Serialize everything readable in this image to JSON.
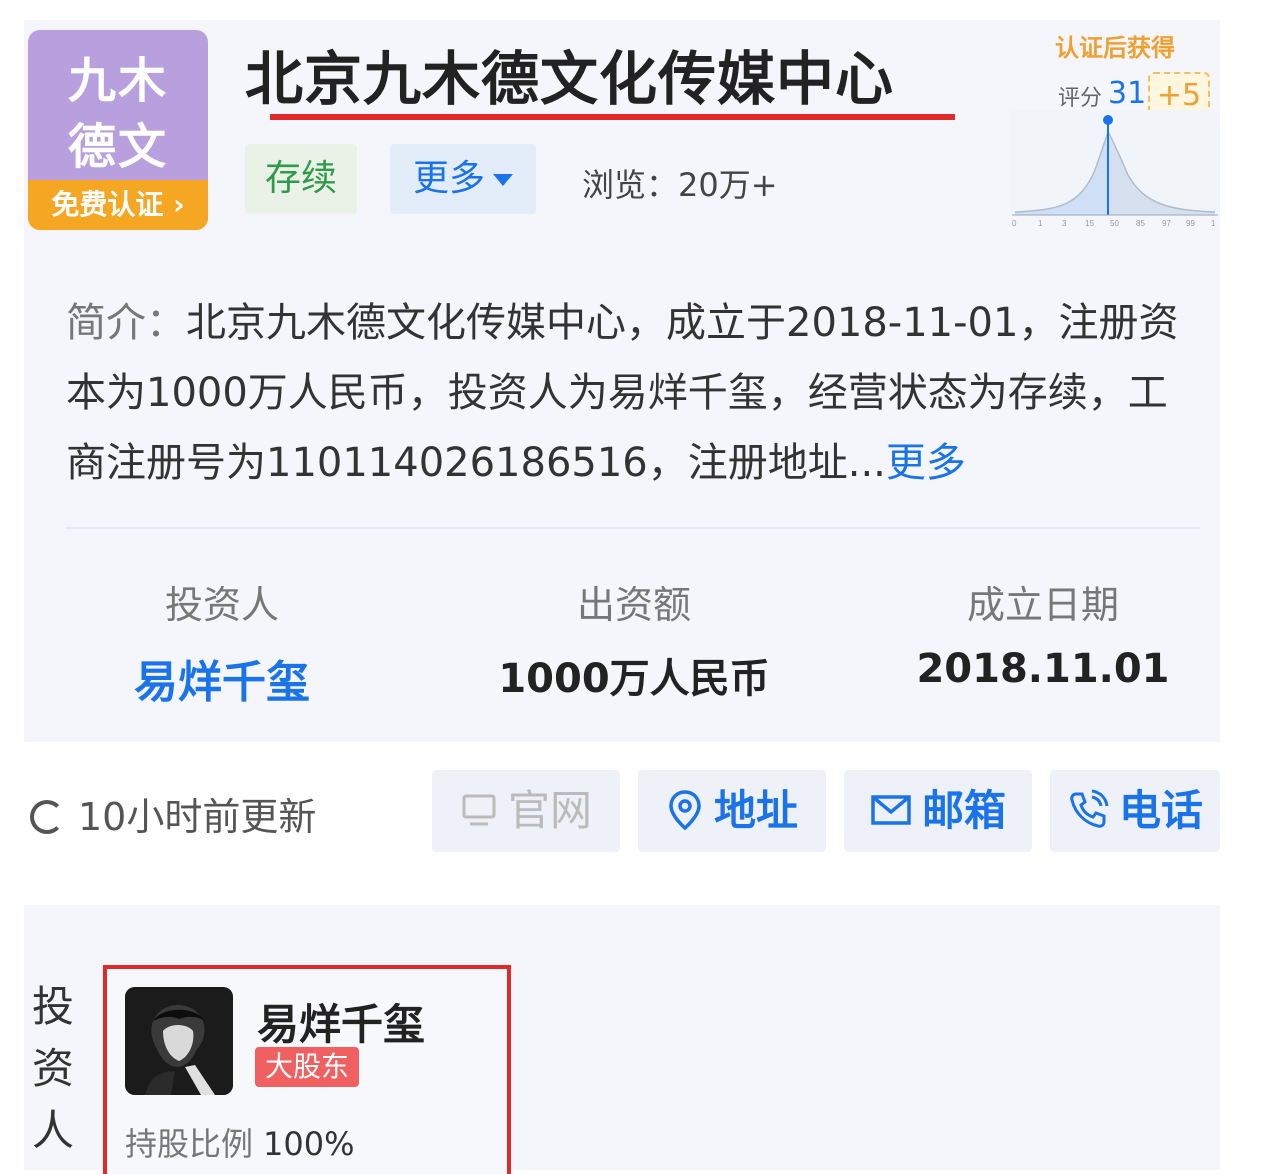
{
  "company": {
    "logo_text_line1": "九木",
    "logo_text_line2": "德文",
    "logo_badge": "免费认证 ›",
    "name": "北京九木德文化传媒中心",
    "status_tag": "存续",
    "more_tag": "更多",
    "views": "浏览：20万+"
  },
  "score": {
    "badge": "认证后获得",
    "label": "评分",
    "value": "31",
    "plus": "+5"
  },
  "intro": {
    "label": "简介：",
    "text": "北京九木德文化传媒中心，成立于2018-11-01，注册资本为1000万人民币，投资人为易烊千玺，经营状态为存续，工商注册号为110114026186516，注册地址...",
    "more": "更多"
  },
  "stats": [
    {
      "label": "投资人",
      "value": "易烊千玺"
    },
    {
      "label": "出资额",
      "value": "1000万人民币"
    },
    {
      "label": "成立日期",
      "value": "2018.11.01"
    }
  ],
  "update_text": "10小时前更新",
  "actions": [
    {
      "label": "官网",
      "icon": "monitor-icon"
    },
    {
      "label": "地址",
      "icon": "location-pin-icon"
    },
    {
      "label": "邮箱",
      "icon": "mail-icon"
    },
    {
      "label": "电话",
      "icon": "phone-icon"
    }
  ],
  "investor_section": {
    "title": "投资人",
    "name": "易烊千玺",
    "badge": "大股东",
    "share_label": "持股比例",
    "share_value": "100%"
  },
  "colors": {
    "accent": "#1a73e8",
    "status_green": "#2e9a4a",
    "highlight_red": "#e02a2a",
    "badge_orange": "#f5a623",
    "logo_purple": "#b8a0de"
  }
}
